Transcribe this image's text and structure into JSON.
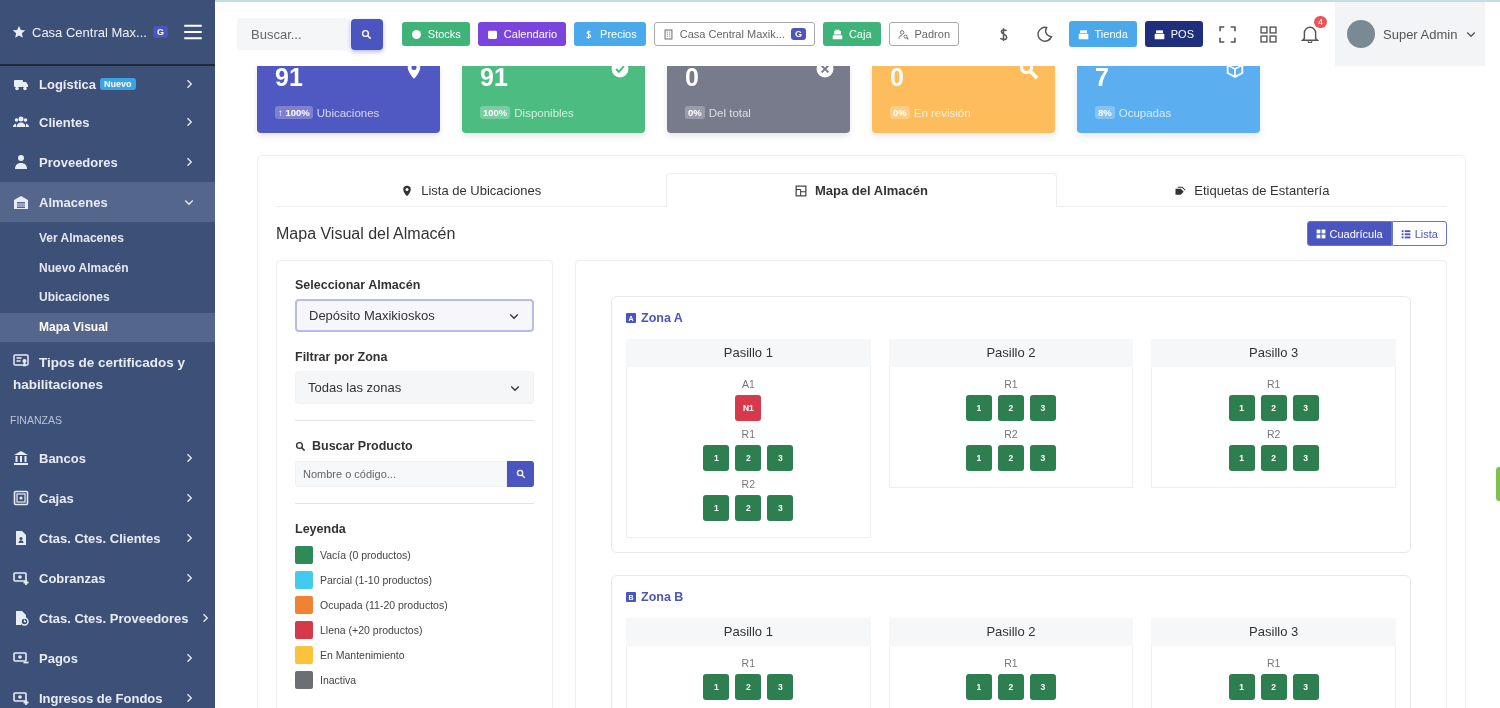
{
  "brand": {
    "name": "Casa Central Max...",
    "badge": "G"
  },
  "sidebar": {
    "items": [
      {
        "kind": "item",
        "label": "Logística",
        "badge": "Nuevo",
        "expanded": false
      },
      {
        "kind": "item",
        "label": "Clientes",
        "expanded": false
      },
      {
        "kind": "item",
        "label": "Proveedores",
        "expanded": false
      },
      {
        "kind": "item",
        "label": "Almacenes",
        "expanded": true,
        "children": [
          {
            "label": "Ver Almacenes",
            "selected": false
          },
          {
            "label": "Nuevo Almacén",
            "selected": false
          },
          {
            "label": "Ubicaciones",
            "selected": false
          },
          {
            "label": "Mapa Visual",
            "selected": true
          }
        ]
      },
      {
        "kind": "leaf",
        "label": "Tipos de certificados y habilitaciones"
      },
      {
        "kind": "section",
        "label": "FINANZAS"
      },
      {
        "kind": "item",
        "label": "Bancos",
        "expanded": false
      },
      {
        "kind": "item",
        "label": "Cajas",
        "expanded": false
      },
      {
        "kind": "item",
        "label": "Ctas. Ctes. Clientes",
        "expanded": false
      },
      {
        "kind": "item",
        "label": "Cobranzas",
        "expanded": false
      },
      {
        "kind": "item",
        "label": "Ctas. Ctes. Proveedores",
        "expanded": false
      },
      {
        "kind": "item",
        "label": "Pagos",
        "expanded": false
      },
      {
        "kind": "item",
        "label": "Ingresos de Fondos",
        "expanded": false
      }
    ]
  },
  "topbar": {
    "search": {
      "placeholder": "Buscar..."
    },
    "buttons": [
      {
        "kind": "solid",
        "label": "Stocks",
        "color": "#3fb37a"
      },
      {
        "kind": "solid",
        "label": "Calendario",
        "color": "#7a45dc"
      },
      {
        "kind": "solid",
        "label": "Precios",
        "color": "#4aa9ea"
      },
      {
        "kind": "outline",
        "label": "Casa Central Maxik...",
        "badge": "G"
      },
      {
        "kind": "solid",
        "label": "Caja",
        "color": "#3fb37a"
      },
      {
        "kind": "outline",
        "label": "Padron"
      }
    ],
    "right_buttons": [
      {
        "label": "Tienda",
        "color": "#4aa9ea"
      },
      {
        "label": "POS",
        "color": "#1f2f7c"
      }
    ],
    "notifications": "4",
    "user": "Super Admin"
  },
  "stats": [
    {
      "value": "91",
      "badge": "↑ 100%",
      "label": "Ubicaciones",
      "color": "#5059c1"
    },
    {
      "value": "91",
      "badge": "100%",
      "label": "Disponibles",
      "color": "#4cbc80"
    },
    {
      "value": "0",
      "badge": "0%",
      "label": "Del total",
      "color": "#777b8c"
    },
    {
      "value": "0",
      "badge": "0%",
      "label": "En revisión",
      "color": "#fdbd5c"
    },
    {
      "value": "7",
      "badge": "8%",
      "label": "Ocupadas",
      "color": "#5baff0"
    }
  ],
  "tabs": [
    {
      "label": "Lista de Ubicaciones",
      "selected": false
    },
    {
      "label": "Mapa del Almacén",
      "selected": true
    },
    {
      "label": "Etiquetas de Estantería",
      "selected": false
    }
  ],
  "map": {
    "title": "Mapa Visual del Almacén",
    "view_toggle": [
      {
        "label": "Cuadrícula",
        "selected": true
      },
      {
        "label": "Lista",
        "selected": false
      }
    ],
    "filters": {
      "warehouse_label": "Seleccionar Almacén",
      "warehouse_value": "Depósito Maxikioskos",
      "zone_label": "Filtrar por Zona",
      "zone_value": "Todas las zonas",
      "search_label": "Buscar Producto",
      "search_placeholder": "Nombre o código..."
    },
    "legend": {
      "title": "Leyenda",
      "items": [
        {
          "label": "Vacía (0 productos)",
          "color": "#2e8a56"
        },
        {
          "label": "Parcial (1-10 productos)",
          "color": "#44c9ef"
        },
        {
          "label": "Ocupada (11-20 productos)",
          "color": "#f28233"
        },
        {
          "label": "Llena (+20 productos)",
          "color": "#d6394a"
        },
        {
          "label": "En Mantenimiento",
          "color": "#fbc33c"
        },
        {
          "label": "Inactiva",
          "color": "#6b6f74"
        }
      ]
    },
    "zones": [
      {
        "name": "Zona A",
        "icon": "A",
        "aisles": [
          {
            "name": "Pasillo 1",
            "racks": [
              {
                "name": "A1",
                "cells": [
                  {
                    "label": "N1",
                    "color": "#d6394a"
                  }
                ]
              },
              {
                "name": "R1",
                "cells": [
                  {
                    "label": "1",
                    "color": "#2e7f50"
                  },
                  {
                    "label": "2",
                    "color": "#2e7f50"
                  },
                  {
                    "label": "3",
                    "color": "#2e7f50"
                  }
                ]
              },
              {
                "name": "R2",
                "cells": [
                  {
                    "label": "1",
                    "color": "#2e7f50"
                  },
                  {
                    "label": "2",
                    "color": "#2e7f50"
                  },
                  {
                    "label": "3",
                    "color": "#2e7f50"
                  }
                ]
              }
            ]
          },
          {
            "name": "Pasillo 2",
            "racks": [
              {
                "name": "R1",
                "cells": [
                  {
                    "label": "1",
                    "color": "#2e7f50"
                  },
                  {
                    "label": "2",
                    "color": "#2e7f50"
                  },
                  {
                    "label": "3",
                    "color": "#2e7f50"
                  }
                ]
              },
              {
                "name": "R2",
                "cells": [
                  {
                    "label": "1",
                    "color": "#2e7f50"
                  },
                  {
                    "label": "2",
                    "color": "#2e7f50"
                  },
                  {
                    "label": "3",
                    "color": "#2e7f50"
                  }
                ]
              }
            ]
          },
          {
            "name": "Pasillo 3",
            "racks": [
              {
                "name": "R1",
                "cells": [
                  {
                    "label": "1",
                    "color": "#2e7f50"
                  },
                  {
                    "label": "2",
                    "color": "#2e7f50"
                  },
                  {
                    "label": "3",
                    "color": "#2e7f50"
                  }
                ]
              },
              {
                "name": "R2",
                "cells": [
                  {
                    "label": "1",
                    "color": "#2e7f50"
                  },
                  {
                    "label": "2",
                    "color": "#2e7f50"
                  },
                  {
                    "label": "3",
                    "color": "#2e7f50"
                  }
                ]
              }
            ]
          }
        ]
      },
      {
        "name": "Zona B",
        "icon": "B",
        "aisles": [
          {
            "name": "Pasillo 1",
            "racks": [
              {
                "name": "R1",
                "cells": [
                  {
                    "label": "1",
                    "color": "#2e7f50"
                  },
                  {
                    "label": "2",
                    "color": "#2e7f50"
                  },
                  {
                    "label": "3",
                    "color": "#2e7f50"
                  }
                ]
              }
            ]
          },
          {
            "name": "Pasillo 2",
            "racks": [
              {
                "name": "R1",
                "cells": [
                  {
                    "label": "1",
                    "color": "#2e7f50"
                  },
                  {
                    "label": "2",
                    "color": "#2e7f50"
                  },
                  {
                    "label": "3",
                    "color": "#2e7f50"
                  }
                ]
              }
            ]
          },
          {
            "name": "Pasillo 3",
            "racks": [
              {
                "name": "R1",
                "cells": [
                  {
                    "label": "1",
                    "color": "#2e7f50"
                  },
                  {
                    "label": "2",
                    "color": "#2e7f50"
                  },
                  {
                    "label": "3",
                    "color": "#2e7f50"
                  }
                ]
              }
            ]
          }
        ]
      }
    ]
  }
}
